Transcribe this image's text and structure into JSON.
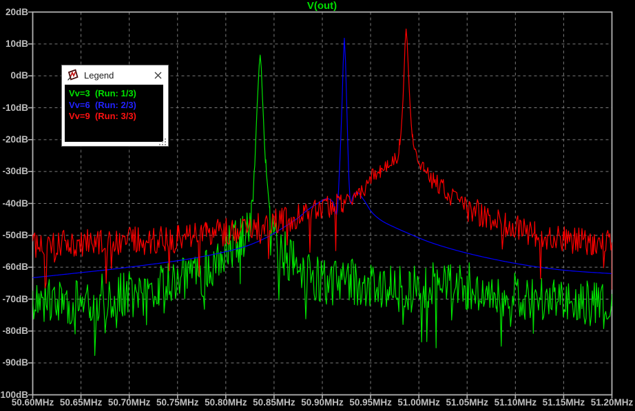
{
  "colors": {
    "background": "#000000",
    "plot_border": "#b2b2b2",
    "grid_dashed": "#7d7d7d",
    "tick_text": "#bfbfbf",
    "title_green": "#00dd00"
  },
  "chart_data": {
    "type": "line",
    "title": "V(out)",
    "grid": true,
    "x_axis": {
      "unit": "MHz",
      "min": 50.6,
      "max": 51.2,
      "tick_step": 0.05,
      "tick_labels": [
        "50.60MHz",
        "50.65MHz",
        "50.70MHz",
        "50.75MHz",
        "50.80MHz",
        "50.85MHz",
        "50.90MHz",
        "50.95MHz",
        "51.00MHz",
        "51.05MHz",
        "51.10MHz",
        "51.15MHz",
        "51.20MHz"
      ]
    },
    "y_axis": {
      "unit": "dB",
      "min": -100,
      "max": 20,
      "tick_step": 10,
      "tick_labels": [
        "20dB",
        "10dB",
        "0dB",
        "-10dB",
        "-20dB",
        "-30dB",
        "-40dB",
        "-50dB",
        "-60dB",
        "-70dB",
        "-80dB",
        "-90dB",
        "-100dB"
      ]
    },
    "series": [
      {
        "name": "Vv=3 (Run: 1/3)",
        "color": "#00e400",
        "peak": {
          "freq_mhz": 50.836,
          "db": 6
        },
        "noise_pp_db": 15,
        "dip_prob": 0.055,
        "dip_extra_db": 19,
        "seed": 17,
        "samples": 560,
        "envelope": [
          [
            50.6,
            -70
          ],
          [
            50.63,
            -71
          ],
          [
            50.66,
            -70
          ],
          [
            50.7,
            -68.5
          ],
          [
            50.73,
            -66.5
          ],
          [
            50.76,
            -64
          ],
          [
            50.78,
            -61
          ],
          [
            50.795,
            -57
          ],
          [
            50.805,
            -53.5
          ],
          [
            50.815,
            -51.5
          ],
          [
            50.822,
            -50
          ],
          [
            50.8265,
            -47
          ],
          [
            50.83,
            -28
          ],
          [
            50.833,
            -6
          ],
          [
            50.8356,
            6
          ],
          [
            50.8385,
            -10
          ],
          [
            50.8415,
            -30
          ],
          [
            50.8455,
            -48
          ],
          [
            50.852,
            -52
          ],
          [
            50.86,
            -55
          ],
          [
            50.87,
            -58
          ],
          [
            50.88,
            -61
          ],
          [
            50.895,
            -63.5
          ],
          [
            50.91,
            -65
          ],
          [
            50.93,
            -64.5
          ],
          [
            50.95,
            -66
          ],
          [
            50.97,
            -66.5
          ],
          [
            50.99,
            -67
          ],
          [
            51.01,
            -66
          ],
          [
            51.03,
            -65.5
          ],
          [
            51.05,
            -66
          ],
          [
            51.08,
            -68
          ],
          [
            51.11,
            -69
          ],
          [
            51.14,
            -70
          ],
          [
            51.17,
            -71
          ],
          [
            51.2,
            -72.5
          ]
        ]
      },
      {
        "name": "Vv=6 (Run: 2/3)",
        "color": "#0000ff",
        "peak": {
          "freq_mhz": 50.923,
          "db": 11.8
        },
        "noise_pp_db": 0,
        "dip_prob": 0,
        "dip_extra_db": 0,
        "seed": 5,
        "samples": 500,
        "envelope": [
          [
            50.6,
            -63.3
          ],
          [
            50.64,
            -62
          ],
          [
            50.68,
            -60.7
          ],
          [
            50.72,
            -59.2
          ],
          [
            50.76,
            -57.5
          ],
          [
            50.79,
            -55.8
          ],
          [
            50.82,
            -53.5
          ],
          [
            50.84,
            -51
          ],
          [
            50.86,
            -47.5
          ],
          [
            50.875,
            -44.5
          ],
          [
            50.885,
            -42
          ],
          [
            50.895,
            -40
          ],
          [
            50.905,
            -38.5
          ],
          [
            50.911,
            -39.5
          ],
          [
            50.9148,
            -43.5
          ],
          [
            50.918,
            -28
          ],
          [
            50.9205,
            -8
          ],
          [
            50.9228,
            11.8
          ],
          [
            50.9252,
            -8
          ],
          [
            50.9275,
            -32
          ],
          [
            50.9292,
            -40
          ],
          [
            50.932,
            -37.5
          ],
          [
            50.936,
            -36.5
          ],
          [
            50.942,
            -38.5
          ],
          [
            50.952,
            -43
          ],
          [
            50.962,
            -45.5
          ],
          [
            50.975,
            -47.5
          ],
          [
            50.99,
            -49.5
          ],
          [
            51.01,
            -52
          ],
          [
            51.04,
            -54.8
          ],
          [
            51.07,
            -57
          ],
          [
            51.1,
            -58.8
          ],
          [
            51.13,
            -60.2
          ],
          [
            51.16,
            -61.2
          ],
          [
            51.2,
            -62
          ]
        ]
      },
      {
        "name": "Vv=9 (Run: 3/3)",
        "color": "#ff0000",
        "peak": {
          "freq_mhz": 50.987,
          "db": 14.5
        },
        "noise_pp_db": 9,
        "dip_prob": 0.045,
        "dip_extra_db": 14,
        "seed": 41,
        "samples": 560,
        "envelope": [
          [
            50.6,
            -53
          ],
          [
            50.64,
            -52.5
          ],
          [
            50.68,
            -52
          ],
          [
            50.72,
            -51.5
          ],
          [
            50.75,
            -51
          ],
          [
            50.78,
            -50
          ],
          [
            50.81,
            -48.5
          ],
          [
            50.84,
            -47
          ],
          [
            50.86,
            -45.5
          ],
          [
            50.88,
            -43.5
          ],
          [
            50.9,
            -41.5
          ],
          [
            50.92,
            -40
          ],
          [
            50.935,
            -37.5
          ],
          [
            50.95,
            -33
          ],
          [
            50.96,
            -30
          ],
          [
            50.968,
            -28
          ],
          [
            50.975,
            -26.5
          ],
          [
            50.98,
            -22
          ],
          [
            50.9835,
            -8
          ],
          [
            50.9868,
            14.5
          ],
          [
            50.99,
            -4
          ],
          [
            50.9935,
            -20
          ],
          [
            50.998,
            -26
          ],
          [
            51.005,
            -28.5
          ],
          [
            51.015,
            -32.5
          ],
          [
            51.03,
            -36.5
          ],
          [
            51.05,
            -41
          ],
          [
            51.07,
            -44.5
          ],
          [
            51.09,
            -47
          ],
          [
            51.12,
            -49.5
          ],
          [
            51.15,
            -51
          ],
          [
            51.18,
            -52.5
          ],
          [
            51.2,
            -53
          ]
        ]
      }
    ]
  },
  "legend_window": {
    "title": "Legend",
    "entries": [
      {
        "text": "Vv=3  (Run: 1/3)",
        "color": "#00e400"
      },
      {
        "text": "Vv=6  (Run: 2/3)",
        "color": "#2222ff"
      },
      {
        "text": "Vv=9  (Run: 3/3)",
        "color": "#ff1111"
      }
    ]
  }
}
